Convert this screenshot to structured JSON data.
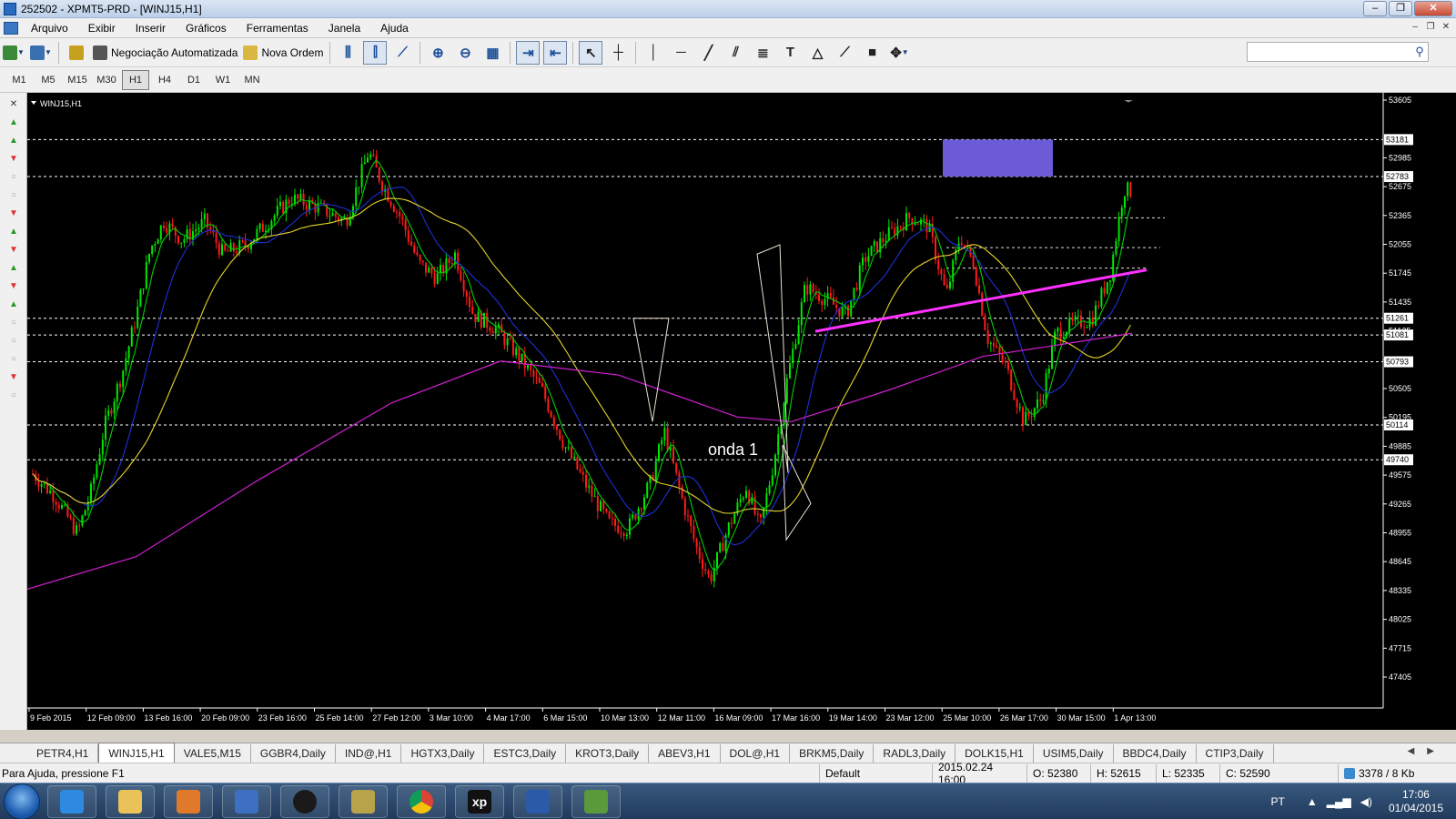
{
  "window": {
    "title": "252502 - XPMT5-PRD - [WINJ15,H1]"
  },
  "menu": [
    "Arquivo",
    "Exibir",
    "Inserir",
    "Gráficos",
    "Ferramentas",
    "Janela",
    "Ajuda"
  ],
  "toolbar": {
    "auto_trading_label": "Negociação Automatizada",
    "new_order_label": "Nova Ordem",
    "search_placeholder": ""
  },
  "timeframes": [
    "M1",
    "M5",
    "M15",
    "M30",
    "H1",
    "H4",
    "D1",
    "W1",
    "MN"
  ],
  "active_timeframe": "H1",
  "chart": {
    "symbol_label": "WINJ15,H1",
    "annotation": "onda 1",
    "background": "#000000",
    "price_axis": [
      "53605",
      "52985",
      "52675",
      "52365",
      "52055",
      "51745",
      "51435",
      "51125",
      "50815",
      "50505",
      "50195",
      "49885",
      "49575",
      "49265",
      "48955",
      "48645",
      "48335",
      "48025",
      "47715",
      "47405"
    ],
    "level_tags": [
      {
        "value": "53181",
        "price": 53181
      },
      {
        "value": "52783",
        "price": 52783
      },
      {
        "value": "51261",
        "price": 51261
      },
      {
        "value": "51081",
        "price": 51081
      },
      {
        "value": "50793",
        "price": 50793
      },
      {
        "value": "50114",
        "price": 50114
      },
      {
        "value": "49740",
        "price": 49740
      }
    ],
    "time_axis": [
      "9 Feb 2015",
      "12 Feb 09:00",
      "13 Feb 16:00",
      "20 Feb 09:00",
      "23 Feb 16:00",
      "25 Feb 14:00",
      "27 Feb 12:00",
      "3 Mar 10:00",
      "4 Mar 17:00",
      "6 Mar 15:00",
      "10 Mar 13:00",
      "12 Mar 11:00",
      "16 Mar 09:00",
      "17 Mar 16:00",
      "19 Mar 14:00",
      "23 Mar 12:00",
      "25 Mar 10:00",
      "26 Mar 17:00",
      "30 Mar 15:00",
      "1 Apr 13:00"
    ],
    "colors": {
      "bull": "#00e600",
      "bear": "#ff1a1a",
      "ma_fast": "#00d000",
      "ma_mid": "#1f2fd8",
      "ma_slow": "#e6d42a",
      "ma_long": "#d020d0",
      "trendline": "#ff30ff",
      "rect": "#6b5bd6",
      "grid": "#ffffff"
    }
  },
  "symbol_tabs": [
    "PETR4,H1",
    "WINJ15,H1",
    "VALE5,M15",
    "GGBR4,Daily",
    "IND@,H1",
    "HGTX3,Daily",
    "ESTC3,Daily",
    "KROT3,Daily",
    "ABEV3,H1",
    "DOL@,H1",
    "BRKM5,Daily",
    "RADL3,Daily",
    "DOLK15,H1",
    "USIM5,Daily",
    "BBDC4,Daily",
    "CTIP3,Daily"
  ],
  "active_tab": "WINJ15,H1",
  "status": {
    "help": "Para Ajuda, pressione F1",
    "profile": "Default",
    "datetime": "2015.02.24 16:00",
    "open": "O: 52380",
    "high": "H: 52615",
    "low": "L: 52335",
    "close": "C: 52590",
    "traffic": "3378 / 8 Kb"
  },
  "taskbar": {
    "language": "PT",
    "time": "17:06",
    "date": "01/04/2015",
    "apps": [
      "internet-explorer-icon",
      "folder-icon",
      "media-player-icon",
      "outlook-icon",
      "hp-icon",
      "archive-icon",
      "chrome-icon",
      "xp-icon",
      "word-icon",
      "metatrader-icon"
    ]
  }
}
